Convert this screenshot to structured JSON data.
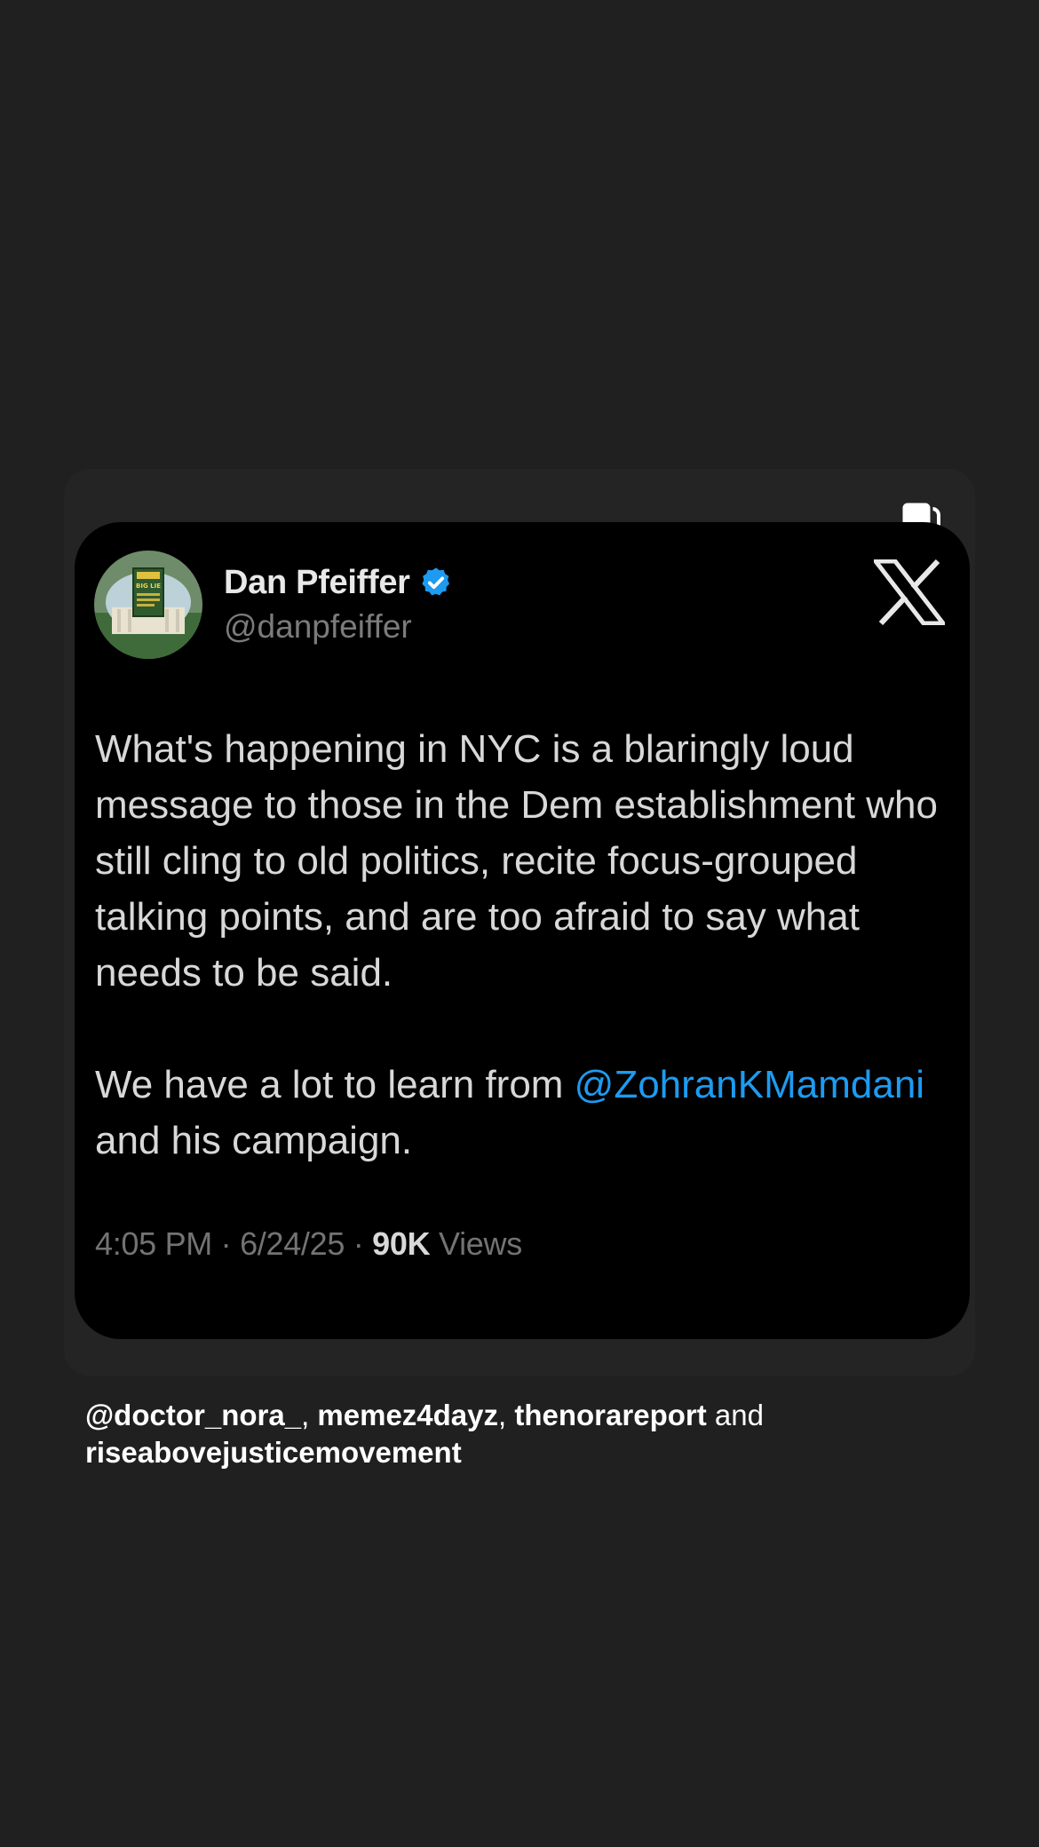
{
  "tweet": {
    "display_name": "Dan Pfeiffer",
    "handle": "@danpfeiffer",
    "paragraph1": "What's happening in NYC is a blaringly loud message to those in the Dem establishment who still cling to old politics, recite focus-grouped talking points, and are too afraid to say what needs to be said.",
    "paragraph2_prefix": "We have a lot to learn from ",
    "mention": "@ZohranKMamdani",
    "paragraph2_suffix": " and his campaign.",
    "time": "4:05 PM",
    "date": "6/24/25",
    "views_count": "90K",
    "views_label": "Views",
    "separator": " · ",
    "avatar_book_text": "BIG LIE",
    "icons": {
      "verified": "verified-badge-icon",
      "x_logo": "x-logo-icon",
      "carousel": "carousel-icon"
    }
  },
  "credits": {
    "user1": "@doctor_nora_",
    "sep1": ", ",
    "user2": "memez4dayz",
    "sep2": ", ",
    "user3": "thenorareport",
    "conj": " and ",
    "user4": "riseabovejusticemovement"
  },
  "colors": {
    "background": "#202020",
    "card": "#242424",
    "tweet_bg": "#000000",
    "mention": "#1d9bf0",
    "verified": "#1d9bf0"
  }
}
